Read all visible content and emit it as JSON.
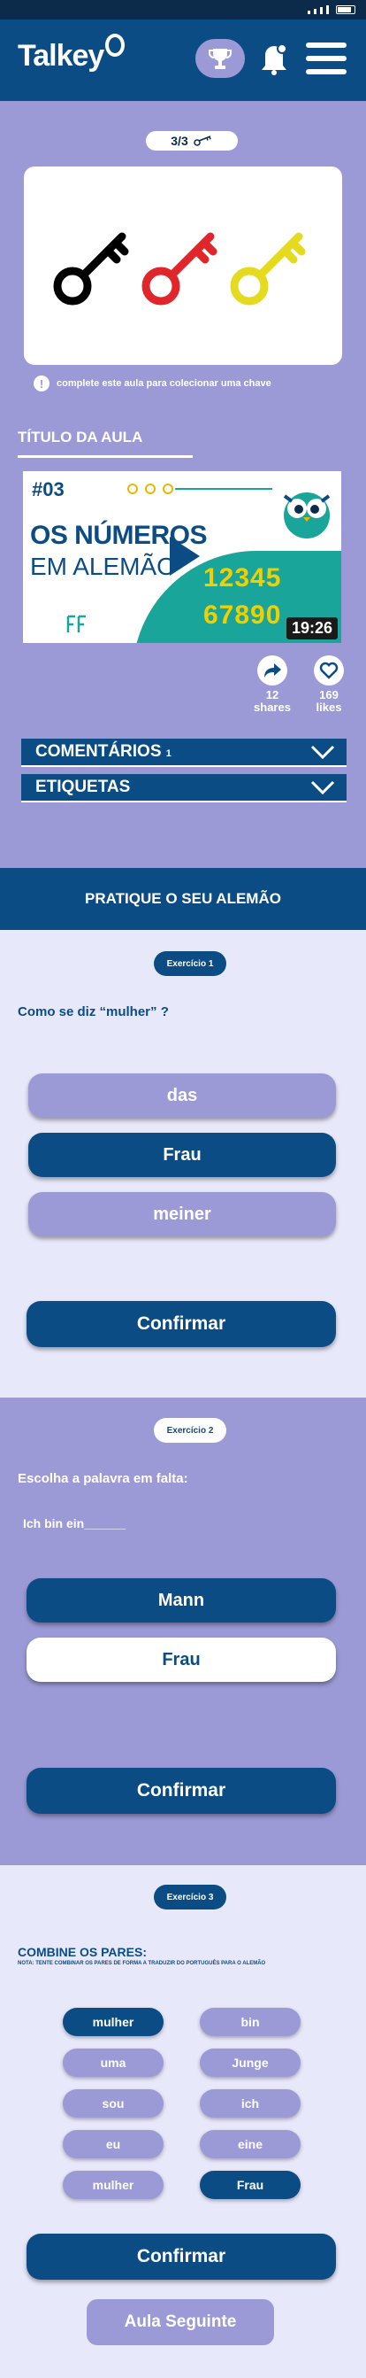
{
  "header": {
    "logo_text": "Talkey",
    "trophy_icon": "trophy-icon",
    "bell_icon": "bell-icon",
    "menu_icon": "menu-icon"
  },
  "keys": {
    "progress_text": "3/3",
    "key_colors": [
      "#000000",
      "#e0262b",
      "#e4da1e"
    ],
    "hint_text": "complete este aula para colecionar uma chave"
  },
  "lesson": {
    "title": "TÍTULO DA AULA",
    "thumbnail": {
      "episode": "#03",
      "title_line1": "OS NÚMEROS",
      "title_line2": "EM ALEMÃO",
      "numbers_line1": "12345",
      "numbers_line2": "67890",
      "duration": "19:26"
    },
    "shares_count": "12",
    "shares_label": "shares",
    "likes_count": "169",
    "likes_label": "likes"
  },
  "accordions": [
    {
      "label": "COMENTÁRIOS",
      "suffix": "1"
    },
    {
      "label": "ETIQUETAS"
    }
  ],
  "practice_title": "PRATIQUE O SEU ALEMÃO",
  "exercise1": {
    "badge": "Exercício 1",
    "question": "Como se diz “mulher” ?",
    "options": [
      "das",
      "Frau",
      "meiner"
    ],
    "selected": "Frau",
    "confirm": "Confirmar"
  },
  "exercise2": {
    "badge": "Exercício 2",
    "question": "Escolha a palavra em falta:",
    "sentence": "Ich bin ein______",
    "options": [
      "Mann",
      "Frau"
    ],
    "confirm": "Confirmar"
  },
  "exercise3": {
    "badge": "Exercício 3",
    "title": "COMBINE OS PARES:",
    "note": "NOTA: TENTE COMBINAR OS PARES DE FORMA A TRADUZIR DO PORTUGUÊS PARA O ALEMÃO",
    "left": [
      "mulher",
      "uma",
      "sou",
      "eu",
      "mulher"
    ],
    "right": [
      "bin",
      "Junge",
      "ich",
      "eine",
      "Frau"
    ],
    "confirm": "Confirmar"
  },
  "next_button": "Aula Seguinte"
}
